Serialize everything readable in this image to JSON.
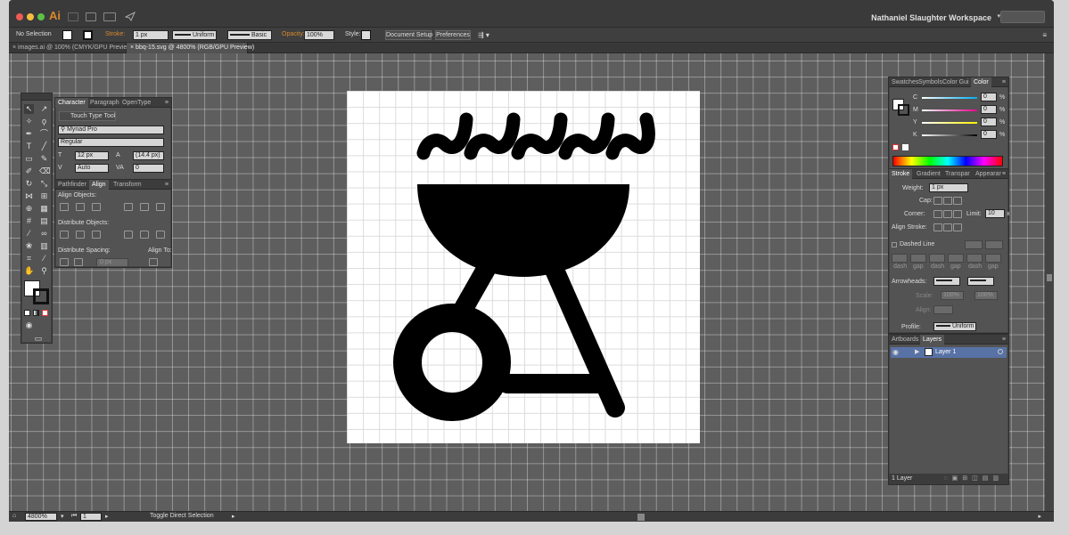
{
  "app": {
    "logo": "Ai",
    "workspace": "Nathaniel Slaughter Workspace"
  },
  "control": {
    "selection": "No Selection",
    "stroke_label": "Stroke:",
    "stroke_value": "1 px",
    "uniform": "Uniform",
    "basic": "Basic",
    "opacity_label": "Opacity:",
    "opacity_value": "100%",
    "style_label": "Style:",
    "document_setup": "Document Setup",
    "preferences": "Preferences"
  },
  "tabs": [
    {
      "label": "images.ai @ 100% (CMYK/GPU Preview)"
    },
    {
      "label": "bbq-15.svg @ 4800% (RGB/GPU Preview)"
    }
  ],
  "character_panel": {
    "tabs": [
      "Character",
      "Paragraph",
      "OpenType"
    ],
    "touch_type": "Touch Type Tool",
    "font": "Myriad Pro",
    "style": "Regular",
    "size": "12 px",
    "leading": "(14.4 px)",
    "kerning": "Auto",
    "tracking": "0"
  },
  "align_panel": {
    "tabs": [
      "Pathfinder",
      "Align",
      "Transform"
    ],
    "align_objects": "Align Objects:",
    "distribute_objects": "Distribute Objects:",
    "distribute_spacing": "Distribute Spacing:",
    "align_to": "Align To:",
    "spacing_value": "0 px"
  },
  "color_panel": {
    "tabs": [
      "Swatches",
      "Symbols",
      "Color Gui",
      "Color"
    ],
    "channels": [
      {
        "label": "C",
        "value": "0"
      },
      {
        "label": "M",
        "value": "0"
      },
      {
        "label": "Y",
        "value": "0"
      },
      {
        "label": "K",
        "value": "0"
      }
    ],
    "unit": "%"
  },
  "stroke_panel": {
    "tabs": [
      "Stroke",
      "Gradient",
      "Transpar",
      "Appearar"
    ],
    "weight_label": "Weight:",
    "weight_value": "1 px",
    "cap_label": "Cap:",
    "corner_label": "Corner:",
    "limit_label": "Limit:",
    "limit_value": "10",
    "limit_unit": "x",
    "align_stroke_label": "Align Stroke:",
    "dashed_line": "Dashed Line",
    "dash_labels": [
      "dash",
      "gap",
      "dash",
      "gap",
      "dash",
      "gap"
    ],
    "arrowheads_label": "Arrowheads:",
    "scale_label": "Scale:",
    "scale_value_1": "100%",
    "scale_value_2": "100%",
    "align_label": "Align:",
    "profile_label": "Profile:",
    "profile_value": "Uniform"
  },
  "layers_panel": {
    "tabs": [
      "Artboards",
      "Layers"
    ],
    "layer_name": "Layer 1",
    "count": "1 Layer"
  },
  "status": {
    "zoom": "4800%",
    "artboard": "1",
    "tool_hint": "Toggle Direct Selection"
  },
  "colors": {
    "accent": "#d9882d",
    "canvas": "#5e5e5e",
    "chrome": "#3c3c3c",
    "layer_highlight": "#5872a6"
  }
}
